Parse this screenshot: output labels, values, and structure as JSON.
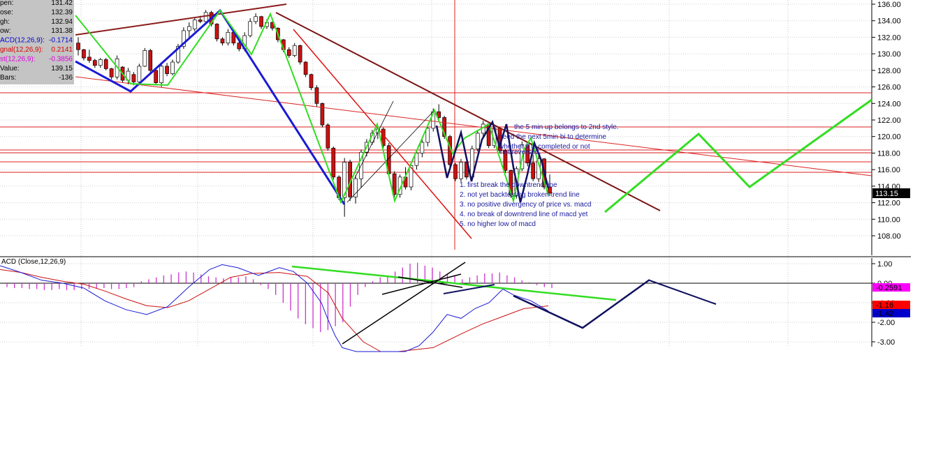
{
  "chart_data": [
    {
      "type": "candlestick",
      "ylim": [
        106.5,
        136.6
      ],
      "y_ticks": [
        "136.00",
        "134.00",
        "132.00",
        "130.00",
        "128.00",
        "126.00",
        "124.00",
        "122.00",
        "120.00",
        "118.00",
        "116.00",
        "114.00",
        "112.00",
        "110.00",
        "108.00"
      ],
      "last_price_label": "113.15",
      "grid": true,
      "info_panel": [
        {
          "label": "pen:",
          "value": "131.42"
        },
        {
          "label": "ose:",
          "value": "132.39"
        },
        {
          "label": "gh:",
          "value": "132.94"
        },
        {
          "label": "ow:",
          "value": "131.38"
        },
        {
          "label": "ACD(12,26,9):",
          "value": "-0.1714",
          "color": "#0000cc"
        },
        {
          "label": "gnal(12,26,9):",
          "value": "0.2141",
          "color": "#dd0000"
        },
        {
          "label": "st(12,26,9):",
          "value": "-0.3856",
          "color": "#dd00dd"
        },
        {
          "label": "Value:",
          "value": "139.15"
        },
        {
          "label": "Bars:",
          "value": "-136"
        }
      ],
      "annotation_top": [
        "the 5 min up belongs to 2nd style.",
        "need the next 5min bi to determine",
        "whether it is completed or not",
        "not reversed."
      ],
      "annotation_list": [
        "1. first break the downtrend line",
        "2. not yet backtesting broken trend line",
        "3. no positive divergency of price vs. macd",
        "4. no break of downtrend line of macd yet",
        "5. no higher low of macd"
      ],
      "candles": [
        [
          131.3,
          132.0,
          129.8,
          130.5
        ],
        [
          130.5,
          130.6,
          129.2,
          129.5
        ],
        [
          129.6,
          130.5,
          128.9,
          129.2
        ],
        [
          129.2,
          129.4,
          128.3,
          128.6
        ],
        [
          128.6,
          129.5,
          128.3,
          129.3
        ],
        [
          129.3,
          129.5,
          128.0,
          128.2
        ],
        [
          128.2,
          128.3,
          126.9,
          127.2
        ],
        [
          127.2,
          129.8,
          126.9,
          129.4
        ],
        [
          128.4,
          128.5,
          126.5,
          126.8
        ],
        [
          126.8,
          128.3,
          126.3,
          127.9
        ],
        [
          127.5,
          127.8,
          126.2,
          126.6
        ],
        [
          126.6,
          128.8,
          126.2,
          128.5
        ],
        [
          128.5,
          130.7,
          128.4,
          130.4
        ],
        [
          130.4,
          130.6,
          127.5,
          128.0
        ],
        [
          128.0,
          128.3,
          126.2,
          126.5
        ],
        [
          126.5,
          128.8,
          126.0,
          128.5
        ],
        [
          128.5,
          128.9,
          127.3,
          127.6
        ],
        [
          127.6,
          129.3,
          127.4,
          129.0
        ],
        [
          129.0,
          131.2,
          128.8,
          130.9
        ],
        [
          130.9,
          133.2,
          130.6,
          132.8
        ],
        [
          132.8,
          133.8,
          132.0,
          133.3
        ],
        [
          133.0,
          134.3,
          132.7,
          134.1
        ],
        [
          134.1,
          134.6,
          133.7,
          133.9
        ],
        [
          133.9,
          135.3,
          133.6,
          135.0
        ],
        [
          135.0,
          135.2,
          133.3,
          133.6
        ],
        [
          133.6,
          133.7,
          131.5,
          131.8
        ],
        [
          131.8,
          132.0,
          131.0,
          131.3
        ],
        [
          131.3,
          133.0,
          131.0,
          132.6
        ],
        [
          132.6,
          132.8,
          131.0,
          131.3
        ],
        [
          131.3,
          131.5,
          130.3,
          130.6
        ],
        [
          130.6,
          132.6,
          130.3,
          132.2
        ],
        [
          132.2,
          134.3,
          132.0,
          133.9
        ],
        [
          133.9,
          134.9,
          133.6,
          134.5
        ],
        [
          134.5,
          134.6,
          133.0,
          133.3
        ],
        [
          133.3,
          134.2,
          133.0,
          133.8
        ],
        [
          133.8,
          133.9,
          132.8,
          133.1
        ],
        [
          133.1,
          133.2,
          131.4,
          131.7
        ],
        [
          131.7,
          131.8,
          130.2,
          130.5
        ],
        [
          130.5,
          130.8,
          129.5,
          129.8
        ],
        [
          129.8,
          131.3,
          129.6,
          131.0
        ],
        [
          131.0,
          131.1,
          128.7,
          129.0
        ],
        [
          129.0,
          129.1,
          127.2,
          127.5
        ],
        [
          127.5,
          127.6,
          125.6,
          125.9
        ],
        [
          125.9,
          126.2,
          123.6,
          124.0
        ],
        [
          124.0,
          124.1,
          121.1,
          121.4
        ],
        [
          121.4,
          121.6,
          118.3,
          118.6
        ],
        [
          118.6,
          118.8,
          114.8,
          115.1
        ],
        [
          115.1,
          115.3,
          112.3,
          112.6
        ],
        [
          112.6,
          117.4,
          110.3,
          116.9
        ],
        [
          116.9,
          117.2,
          112.2,
          112.7
        ],
        [
          112.7,
          115.3,
          111.9,
          114.9
        ],
        [
          114.9,
          118.4,
          113.8,
          118.1
        ],
        [
          118.1,
          119.7,
          117.6,
          119.3
        ],
        [
          119.3,
          120.8,
          119.0,
          120.4
        ],
        [
          120.4,
          121.2,
          119.7,
          120.9
        ],
        [
          120.9,
          121.1,
          118.6,
          118.9
        ],
        [
          118.9,
          119.2,
          115.2,
          115.5
        ],
        [
          115.5,
          115.8,
          112.6,
          113.0
        ],
        [
          113.0,
          115.4,
          112.6,
          115.1
        ],
        [
          115.1,
          116.3,
          113.6,
          113.9
        ],
        [
          113.9,
          116.8,
          113.5,
          116.5
        ],
        [
          116.5,
          118.3,
          116.0,
          118.0
        ],
        [
          118.0,
          119.6,
          117.5,
          119.3
        ],
        [
          119.3,
          121.3,
          118.8,
          121.0
        ],
        [
          121.0,
          123.4,
          120.6,
          123.0
        ],
        [
          123.0,
          123.9,
          122.0,
          122.3
        ],
        [
          122.3,
          122.5,
          119.7,
          120.0
        ],
        [
          120.0,
          120.2,
          116.3,
          116.6
        ],
        [
          116.6,
          116.8,
          114.6,
          114.9
        ],
        [
          114.9,
          117.3,
          114.5,
          116.9
        ],
        [
          116.9,
          117.0,
          114.8,
          115.1
        ],
        [
          115.1,
          118.9,
          114.9,
          118.5
        ],
        [
          118.5,
          120.8,
          118.2,
          120.4
        ],
        [
          120.4,
          121.9,
          120.0,
          121.5
        ],
        [
          121.5,
          121.6,
          118.6,
          118.9
        ],
        [
          118.9,
          121.3,
          118.6,
          121.0
        ],
        [
          121.0,
          121.1,
          118.0,
          118.3
        ],
        [
          118.3,
          118.5,
          115.6,
          115.9
        ],
        [
          115.9,
          116.0,
          112.6,
          112.9
        ],
        [
          112.9,
          116.4,
          112.5,
          116.1
        ],
        [
          116.1,
          119.4,
          115.8,
          119.0
        ],
        [
          119.0,
          119.3,
          116.4,
          116.8
        ],
        [
          116.8,
          117.8,
          114.6,
          114.9
        ],
        [
          114.9,
          117.7,
          114.5,
          117.3
        ],
        [
          117.3,
          117.4,
          113.6,
          113.9
        ],
        [
          113.9,
          115.4,
          112.8,
          113.15
        ]
      ]
    },
    {
      "type": "macd",
      "title": "ACD (Close,12,26,9)",
      "ylim": [
        -3.3,
        1.5
      ],
      "y_ticks": [
        "1.00",
        "0.00",
        "-1.00",
        "-2.00",
        "-3.00"
      ],
      "value_labels": [
        {
          "text": "-0.2591",
          "color": "#ff00ff"
        },
        {
          "text": "-1.16",
          "color": "#ff0000"
        },
        {
          "text": "-1.42",
          "color": "#0000cc"
        }
      ],
      "histogram": [
        -0.2,
        -0.25,
        -0.25,
        -0.3,
        -0.3,
        -0.35,
        -0.35,
        -0.3,
        -0.35,
        -0.35,
        -0.3,
        -0.3,
        -0.25,
        -0.25,
        -0.3,
        -0.3,
        -0.25,
        -0.2,
        0.1,
        0.2,
        0.3,
        0.4,
        0.45,
        0.55,
        0.6,
        0.55,
        0.45,
        0.35,
        0.3,
        0.25,
        0.3,
        0.3,
        0.35,
        0.2,
        -0.1,
        -0.3,
        -0.6,
        -1.0,
        -1.4,
        -1.8,
        -2.1,
        -2.3,
        -2.5,
        -2.4,
        -2.2,
        -2.0,
        -1.2,
        -0.6,
        -0.2,
        0.1,
        0.3,
        0.4,
        0.6,
        0.8,
        1.0,
        1.05,
        0.9,
        0.8,
        0.6,
        0.5,
        0.4,
        0.2,
        0.3,
        0.4,
        0.5,
        0.5,
        0.55,
        0.4,
        0.3,
        0.15,
        0.05,
        -0.1,
        -0.2,
        -0.25
      ],
      "macd": [
        [
          0,
          0.9
        ],
        [
          30,
          0.55
        ],
        [
          60,
          0.15
        ],
        [
          90,
          0.0
        ],
        [
          120,
          -0.25
        ],
        [
          150,
          -0.9
        ],
        [
          180,
          -1.35
        ],
        [
          210,
          -1.6
        ],
        [
          240,
          -1.2
        ],
        [
          270,
          -0.2
        ],
        [
          300,
          0.7
        ],
        [
          318,
          0.95
        ],
        [
          340,
          0.8
        ],
        [
          370,
          0.4
        ],
        [
          400,
          0.8
        ],
        [
          420,
          0.6
        ],
        [
          440,
          0.0
        ],
        [
          460,
          -1.0
        ],
        [
          470,
          -1.9
        ],
        [
          480,
          -2.7
        ],
        [
          490,
          -3.3
        ],
        [
          510,
          -3.5
        ],
        [
          560,
          -3.5
        ],
        [
          580,
          -3.5
        ],
        [
          600,
          -3.2
        ],
        [
          620,
          -2.5
        ],
        [
          640,
          -1.6
        ],
        [
          660,
          -1.8
        ],
        [
          680,
          -1.3
        ],
        [
          700,
          -1.0
        ],
        [
          720,
          -0.3
        ],
        [
          735,
          -0.6
        ],
        [
          760,
          -0.9
        ],
        [
          785,
          -1.42
        ]
      ],
      "signal": [
        [
          0,
          0.7
        ],
        [
          30,
          0.55
        ],
        [
          60,
          0.3
        ],
        [
          90,
          0.1
        ],
        [
          120,
          -0.05
        ],
        [
          150,
          -0.4
        ],
        [
          180,
          -0.8
        ],
        [
          210,
          -1.15
        ],
        [
          240,
          -1.25
        ],
        [
          270,
          -0.9
        ],
        [
          300,
          -0.3
        ],
        [
          330,
          0.3
        ],
        [
          360,
          0.5
        ],
        [
          400,
          0.55
        ],
        [
          440,
          0.35
        ],
        [
          470,
          -0.5
        ],
        [
          490,
          -1.8
        ],
        [
          520,
          -3.0
        ],
        [
          545,
          -3.5
        ],
        [
          570,
          -3.5
        ],
        [
          620,
          -3.3
        ],
        [
          660,
          -2.6
        ],
        [
          690,
          -2.1
        ],
        [
          720,
          -1.7
        ],
        [
          750,
          -1.3
        ],
        [
          785,
          -1.16
        ]
      ]
    }
  ]
}
